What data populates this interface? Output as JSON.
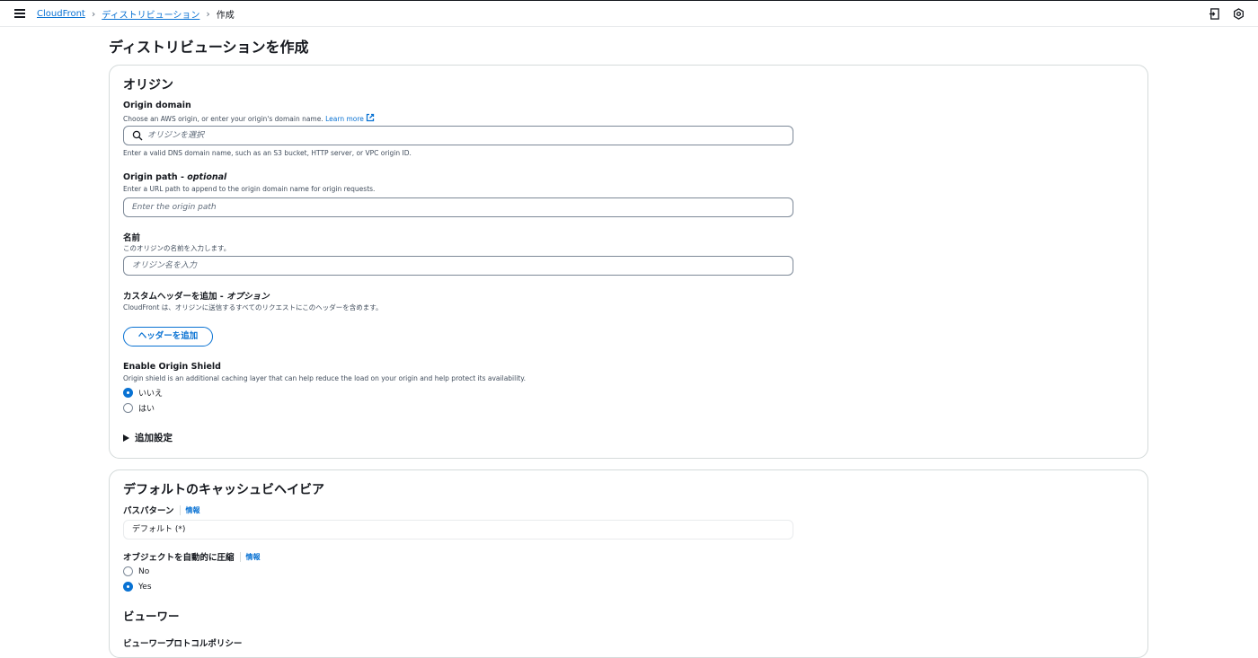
{
  "breadcrumb": {
    "items": [
      "CloudFront",
      "ディストリビューション"
    ],
    "current": "作成"
  },
  "page": {
    "title": "ディストリビューションを作成"
  },
  "origin_section": {
    "title": "オリジン",
    "origin_domain": {
      "label": "Origin domain",
      "description": "Choose an AWS origin, or enter your origin's domain name.",
      "learn_more": "Learn more",
      "placeholder": "オリジンを選択",
      "hint": "Enter a valid DNS domain name, such as an S3 bucket, HTTP server, or VPC origin ID."
    },
    "origin_path": {
      "label": "Origin path - ",
      "label_optional": "optional",
      "description": "Enter a URL path to append to the origin domain name for origin requests.",
      "placeholder": "Enter the origin path"
    },
    "name": {
      "label": "名前",
      "description": "このオリジンの名前を入力します。",
      "placeholder": "オリジン名を入力"
    },
    "custom_header": {
      "label": "カスタムヘッダーを追加 - ",
      "label_optional": "オプション",
      "description": "CloudFront は、オリジンに送信するすべてのリクエストにこのヘッダーを含めます。",
      "button": "ヘッダーを追加"
    },
    "origin_shield": {
      "label": "Enable Origin Shield",
      "description": "Origin shield is an additional caching layer that can help reduce the load on your origin and help protect its availability.",
      "options": [
        "いいえ",
        "はい"
      ],
      "selected": "いいえ"
    },
    "additional_settings": "追加設定"
  },
  "cache_section": {
    "title": "デフォルトのキャッシュビヘイビア",
    "path_pattern": {
      "label": "パスパターン",
      "info": "情報",
      "value": "デフォルト (*)"
    },
    "compress": {
      "label": "オブジェクトを自動的に圧縮",
      "info": "情報",
      "options": [
        "No",
        "Yes"
      ],
      "selected": "Yes"
    },
    "viewer": {
      "title": "ビューワー",
      "protocol_policy_label": "ビューワープロトコルポリシー"
    }
  },
  "colors": {
    "link": "#0972d3",
    "text": "#16191f",
    "border": "#7d8998"
  }
}
